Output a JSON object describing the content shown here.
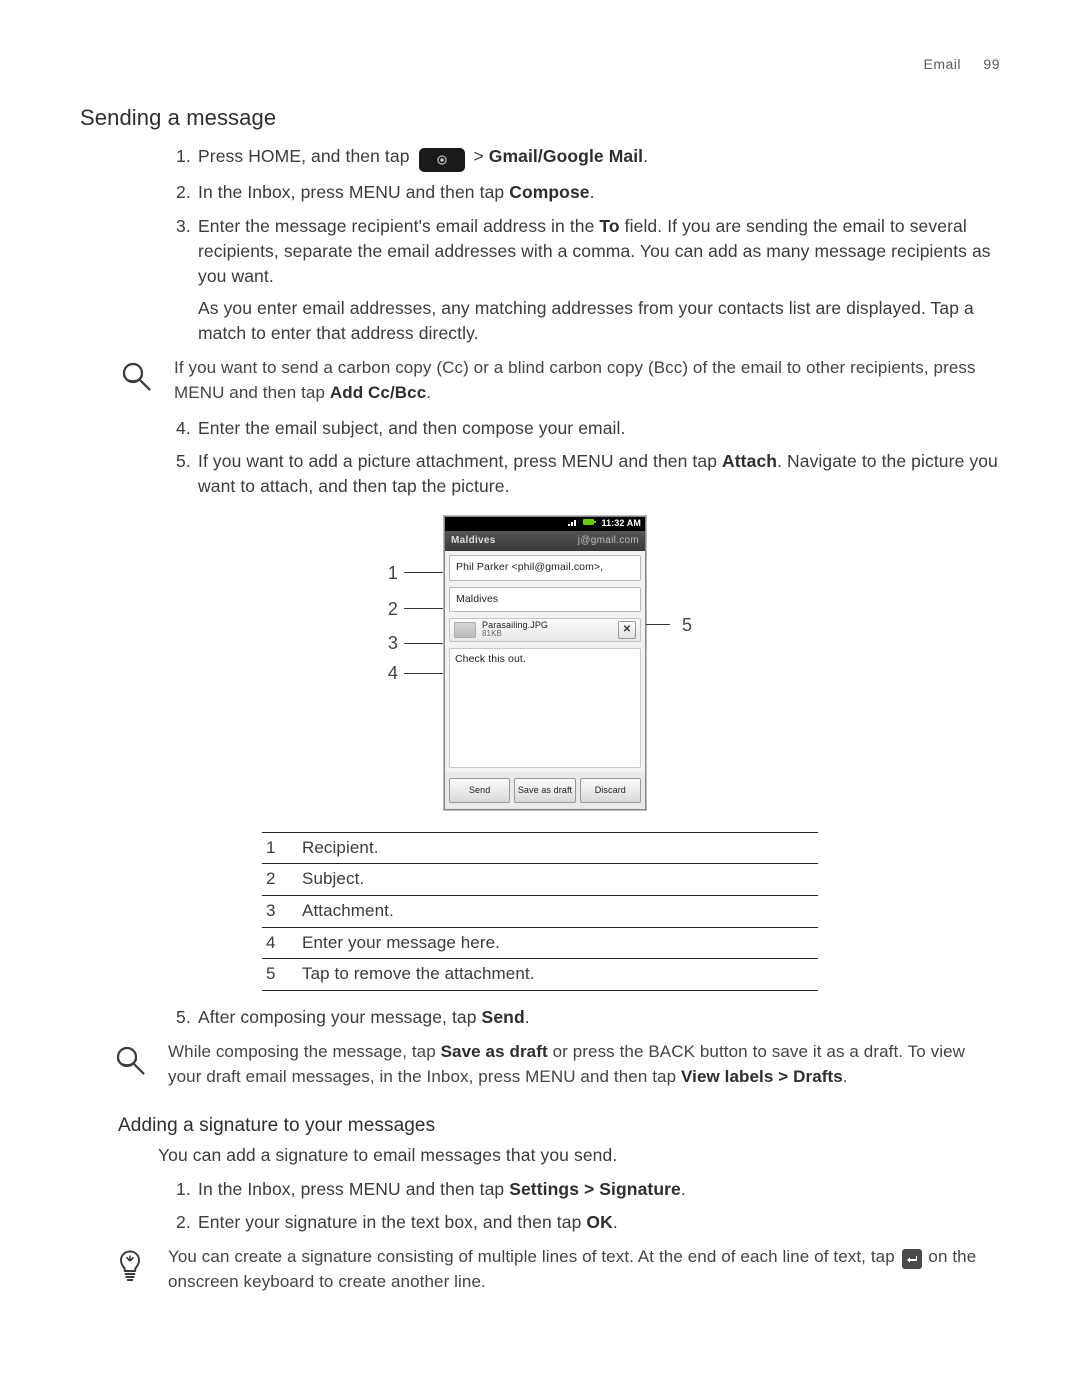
{
  "header": {
    "section": "Email",
    "page_number": "99"
  },
  "section_title": "Sending a message",
  "step1": {
    "pre": "Press HOME, and then tap ",
    "post_gt": " > ",
    "app_label": "Gmail/Google Mail",
    "end": "."
  },
  "step2": {
    "pre": "In the Inbox, press MENU and then tap ",
    "bold": "Compose",
    "end": "."
  },
  "step3": {
    "p1a": "Enter the message recipient's email address in the ",
    "to": "To",
    "p1b": " field. If you are sending the email to several recipients, separate the email addresses with a comma. You can add as many message recipients as you want.",
    "p2": "As you enter email addresses, any matching addresses from your contacts list are displayed. Tap a match to enter that address directly."
  },
  "note_cc": {
    "pre": "If you want to send a carbon copy (Cc) or a blind carbon copy (Bcc) of the email to other recipients, press MENU and then tap ",
    "bold": "Add Cc/Bcc",
    "end": "."
  },
  "step4": "Enter the email subject, and then compose your email.",
  "step5a": {
    "pre": "If you want to add a picture attachment, press MENU and then tap ",
    "bold": "Attach",
    "post": ". Navigate to the picture you want to attach, and then tap the picture."
  },
  "phone": {
    "time": "11:32 AM",
    "title_left": "Maldives",
    "title_right": "j@gmail.com",
    "to_field": "Phil Parker <phil@gmail.com>,",
    "subject_field": "Maldives",
    "attachment_name": "Parasailing.JPG",
    "attachment_size": "81KB",
    "message_body": "Check this out.",
    "btn_send": "Send",
    "btn_save": "Save as draft",
    "btn_discard": "Discard"
  },
  "callouts": {
    "c1": "1",
    "c2": "2",
    "c3": "3",
    "c4": "4",
    "c5": "5"
  },
  "legend": [
    {
      "n": "1",
      "t": "Recipient."
    },
    {
      "n": "2",
      "t": "Subject."
    },
    {
      "n": "3",
      "t": "Attachment."
    },
    {
      "n": "4",
      "t": "Enter your message here."
    },
    {
      "n": "5",
      "t": "Tap to remove the attachment."
    }
  ],
  "step5b": {
    "pre": "After composing your message, tap ",
    "bold": "Send",
    "end": "."
  },
  "note_draft": {
    "p1a": "While composing the message, tap ",
    "b1": "Save as draft",
    "p1b": " or press the BACK button to save it as a draft. To view your draft email messages, in the Inbox, press MENU and then tap ",
    "b2": "View labels > Drafts",
    "end": "."
  },
  "sub2_title": "Adding a signature to your messages",
  "sub2_intro": "You can add a signature to email messages that you send.",
  "sub2_step1": {
    "pre": "In the Inbox, press MENU and then tap ",
    "bold": "Settings > Signature",
    "end": "."
  },
  "sub2_step2": {
    "pre": "Enter your signature in the text box, and then tap ",
    "bold": "OK",
    "end": "."
  },
  "tip_sig": {
    "pre": "You can create a signature consisting of multiple lines of text. At the end of each line of text, tap ",
    "post": " on the onscreen keyboard to create another line."
  }
}
